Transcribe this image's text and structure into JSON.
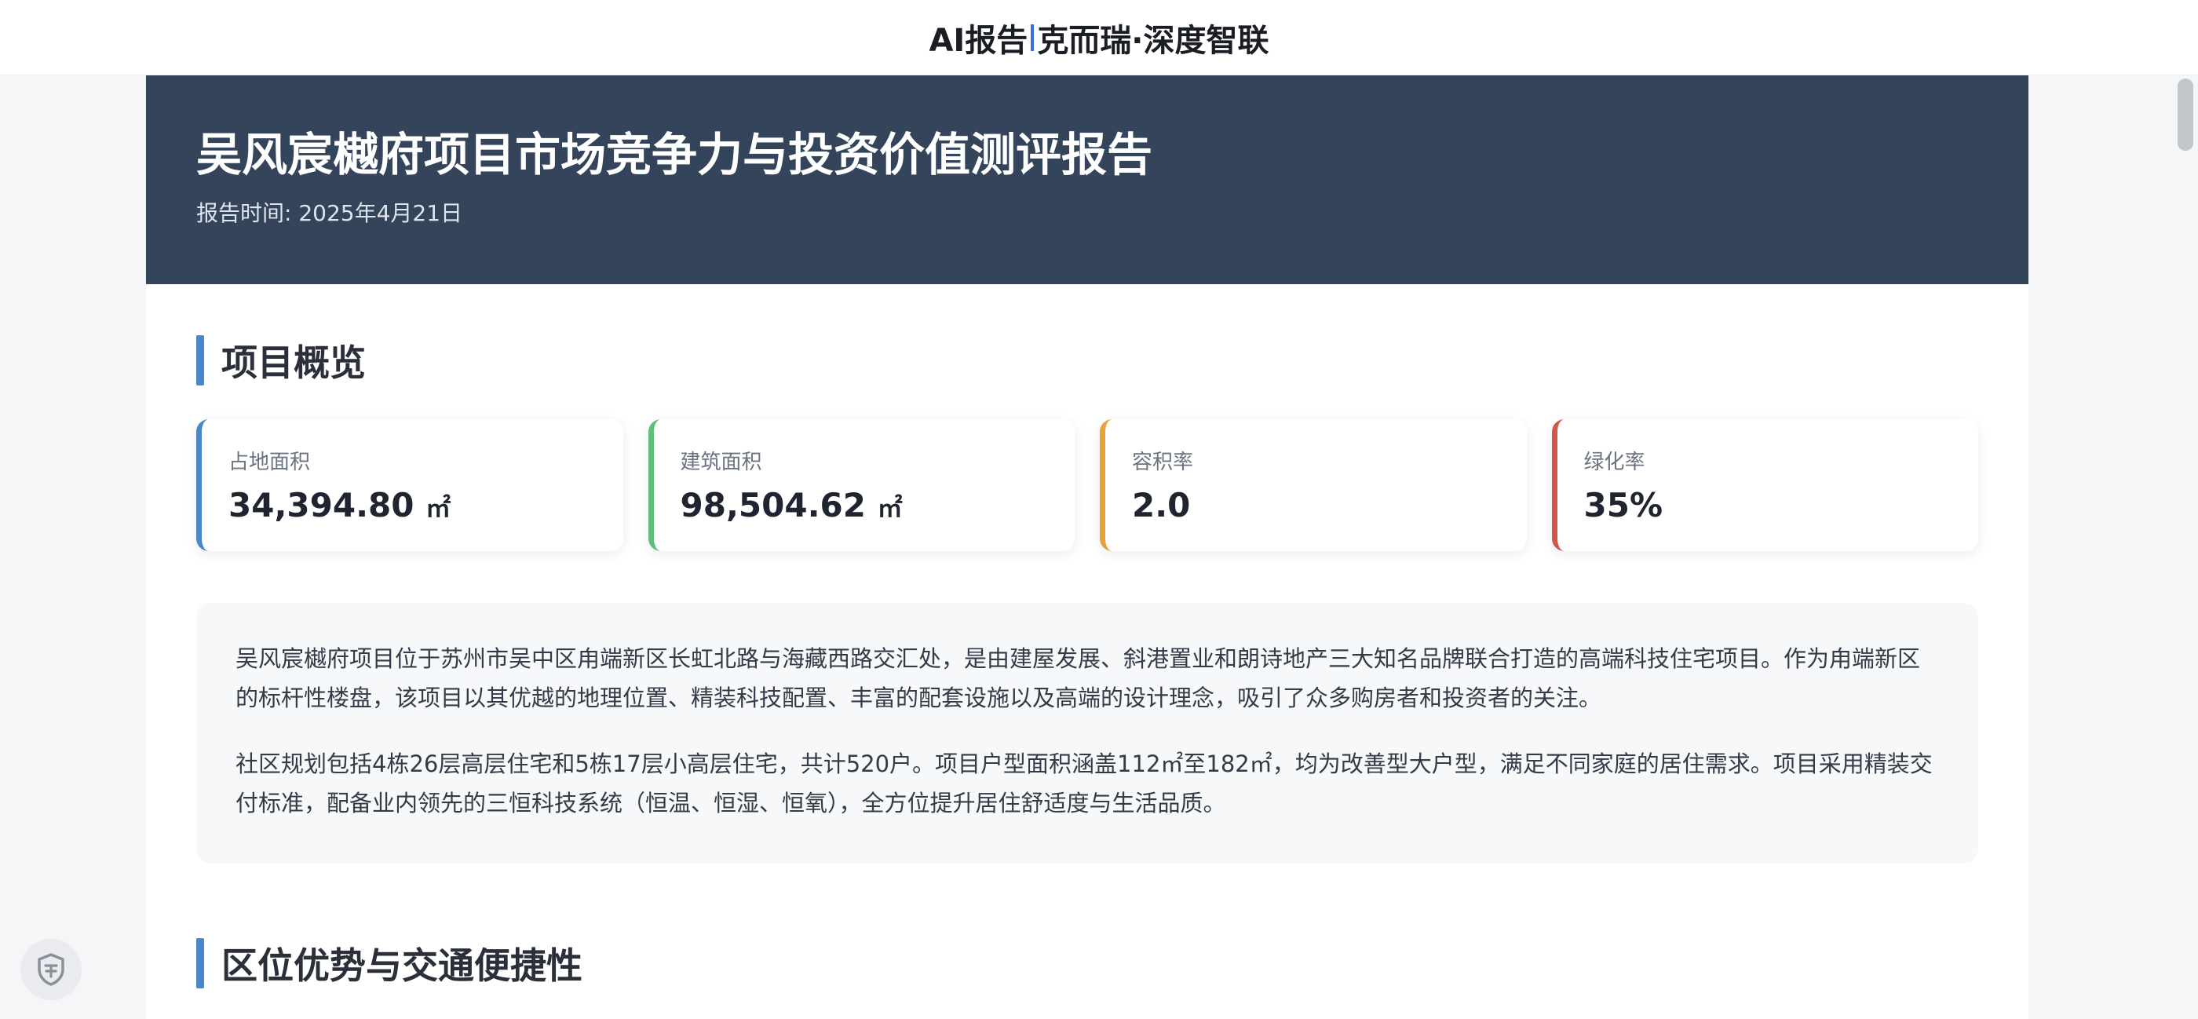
{
  "header": {
    "brand_left": "AI报告",
    "brand_right": "克而瑞·深度智联"
  },
  "report": {
    "title": "吴风宸樾府项目市场竞争力与投资价值测评报告",
    "date": "报告时间: 2025年4月21日"
  },
  "overview": {
    "title": "项目概览",
    "cards": [
      {
        "label": "占地面积",
        "value": "34,394.80",
        "unit": "㎡",
        "color": "#4a86c8"
      },
      {
        "label": "建筑面积",
        "value": "98,504.62",
        "unit": "㎡",
        "color": "#5cc07a"
      },
      {
        "label": "容积率",
        "value": "2.0",
        "unit": "",
        "color": "#e8a23c"
      },
      {
        "label": "绿化率",
        "value": "35%",
        "unit": "",
        "color": "#d0574a"
      }
    ],
    "paragraphs": [
      "吴风宸樾府项目位于苏州市吴中区甪端新区长虹北路与海藏西路交汇处，是由建屋发展、斜港置业和朗诗地产三大知名品牌联合打造的高端科技住宅项目。作为甪端新区的标杆性楼盘，该项目以其优越的地理位置、精装科技配置、丰富的配套设施以及高端的设计理念，吸引了众多购房者和投资者的关注。",
      "社区规划包括4栋26层高层住宅和5栋17层小高层住宅，共计520户。项目户型面积涵盖112㎡至182㎡，均为改善型大户型，满足不同家庭的居住需求。项目采用精装交付标准，配备业内领先的三恒科技系统（恒温、恒湿、恒氧），全方位提升居住舒适度与生活品质。"
    ]
  },
  "location": {
    "title": "区位优势与交通便捷性"
  },
  "widgets": {
    "shield_icon": "shield-icon"
  }
}
